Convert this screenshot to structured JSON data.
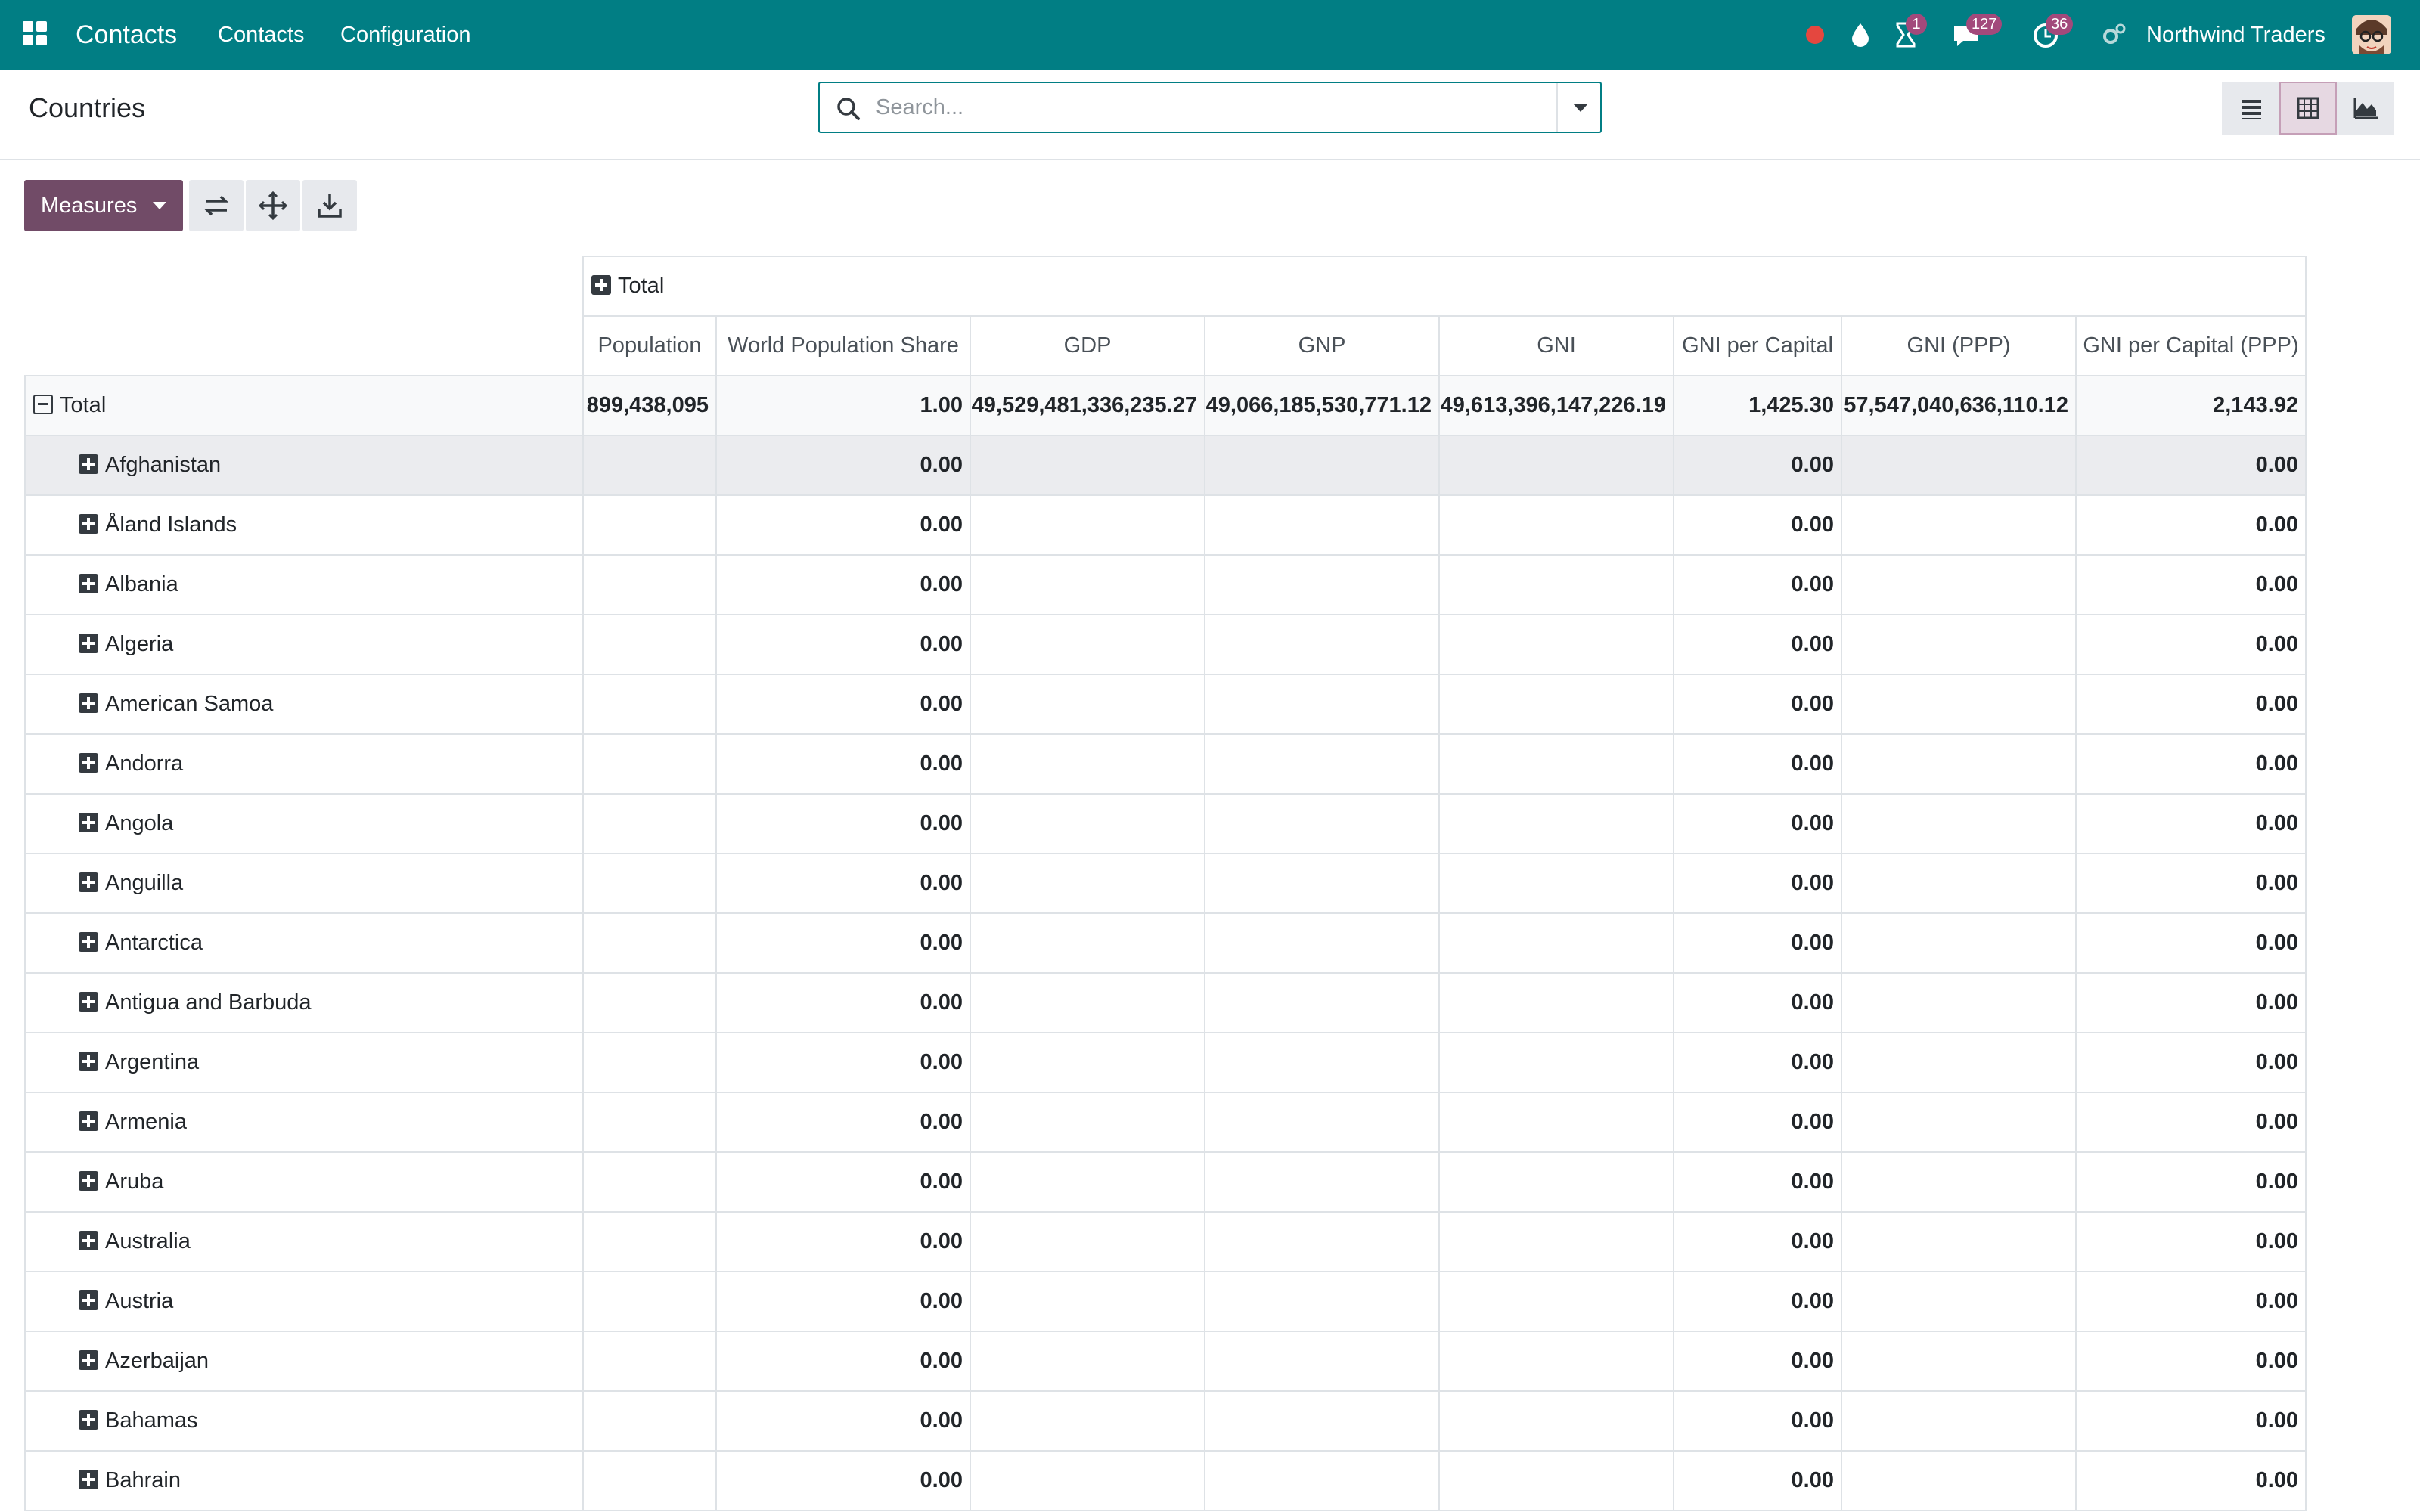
{
  "navbar": {
    "app_title": "Contacts",
    "menus": [
      "Contacts",
      "Configuration"
    ],
    "badges": {
      "activities": "1",
      "messages": "127",
      "timer": "36"
    },
    "company": "Northwind Traders"
  },
  "control_panel": {
    "breadcrumb": "Countries",
    "search_placeholder": "Search..."
  },
  "toolbar": {
    "measures_label": "Measures"
  },
  "pivot": {
    "col_group_label": "Total",
    "row_total_label": "Total",
    "measures": [
      "Population",
      "World Population Share",
      "GDP",
      "GNP",
      "GNI",
      "GNI per Capital",
      "GNI (PPP)",
      "GNI per Capital (PPP)"
    ],
    "totals": [
      "899,438,095",
      "1.00",
      "49,529,481,336,235.27",
      "49,066,185,530,771.12",
      "49,613,396,147,226.19",
      "1,425.30",
      "57,547,040,636,110.12",
      "2,143.92"
    ],
    "rows": [
      {
        "country": "Afghanistan",
        "values": [
          "",
          "0.00",
          "",
          "",
          "",
          "0.00",
          "",
          "0.00"
        ]
      },
      {
        "country": "Åland Islands",
        "values": [
          "",
          "0.00",
          "",
          "",
          "",
          "0.00",
          "",
          "0.00"
        ]
      },
      {
        "country": "Albania",
        "values": [
          "",
          "0.00",
          "",
          "",
          "",
          "0.00",
          "",
          "0.00"
        ]
      },
      {
        "country": "Algeria",
        "values": [
          "",
          "0.00",
          "",
          "",
          "",
          "0.00",
          "",
          "0.00"
        ]
      },
      {
        "country": "American Samoa",
        "values": [
          "",
          "0.00",
          "",
          "",
          "",
          "0.00",
          "",
          "0.00"
        ]
      },
      {
        "country": "Andorra",
        "values": [
          "",
          "0.00",
          "",
          "",
          "",
          "0.00",
          "",
          "0.00"
        ]
      },
      {
        "country": "Angola",
        "values": [
          "",
          "0.00",
          "",
          "",
          "",
          "0.00",
          "",
          "0.00"
        ]
      },
      {
        "country": "Anguilla",
        "values": [
          "",
          "0.00",
          "",
          "",
          "",
          "0.00",
          "",
          "0.00"
        ]
      },
      {
        "country": "Antarctica",
        "values": [
          "",
          "0.00",
          "",
          "",
          "",
          "0.00",
          "",
          "0.00"
        ]
      },
      {
        "country": "Antigua and Barbuda",
        "values": [
          "",
          "0.00",
          "",
          "",
          "",
          "0.00",
          "",
          "0.00"
        ]
      },
      {
        "country": "Argentina",
        "values": [
          "",
          "0.00",
          "",
          "",
          "",
          "0.00",
          "",
          "0.00"
        ]
      },
      {
        "country": "Armenia",
        "values": [
          "",
          "0.00",
          "",
          "",
          "",
          "0.00",
          "",
          "0.00"
        ]
      },
      {
        "country": "Aruba",
        "values": [
          "",
          "0.00",
          "",
          "",
          "",
          "0.00",
          "",
          "0.00"
        ]
      },
      {
        "country": "Australia",
        "values": [
          "",
          "0.00",
          "",
          "",
          "",
          "0.00",
          "",
          "0.00"
        ]
      },
      {
        "country": "Austria",
        "values": [
          "",
          "0.00",
          "",
          "",
          "",
          "0.00",
          "",
          "0.00"
        ]
      },
      {
        "country": "Azerbaijan",
        "values": [
          "",
          "0.00",
          "",
          "",
          "",
          "0.00",
          "",
          "0.00"
        ]
      },
      {
        "country": "Bahamas",
        "values": [
          "",
          "0.00",
          "",
          "",
          "",
          "0.00",
          "",
          "0.00"
        ]
      },
      {
        "country": "Bahrain",
        "values": [
          "",
          "0.00",
          "",
          "",
          "",
          "0.00",
          "",
          "0.00"
        ]
      }
    ]
  }
}
